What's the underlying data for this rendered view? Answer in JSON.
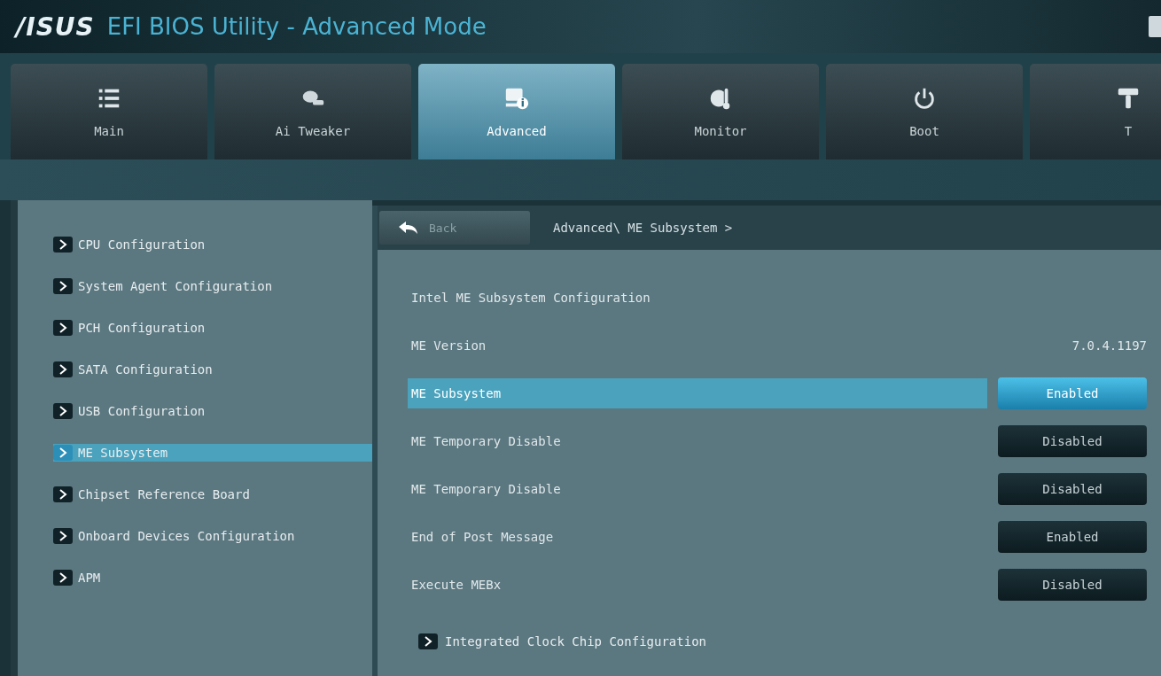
{
  "window": {
    "title_brand": "/ISUS",
    "title": "EFI BIOS Utility - Advanced Mode"
  },
  "tabs": [
    {
      "label": "Main",
      "kind": "list",
      "selected": false
    },
    {
      "label": "Ai Tweaker",
      "kind": "tweak",
      "selected": false
    },
    {
      "label": "Advanced",
      "kind": "advanced",
      "selected": true
    },
    {
      "label": "Monitor",
      "kind": "monitor",
      "selected": false
    },
    {
      "label": "Boot",
      "kind": "power",
      "selected": false
    },
    {
      "label": "T",
      "kind": "tool",
      "selected": false
    }
  ],
  "sidebar": {
    "items": [
      {
        "label": "CPU Configuration",
        "selected": false
      },
      {
        "label": "System Agent Configuration",
        "selected": false
      },
      {
        "label": "PCH Configuration",
        "selected": false
      },
      {
        "label": "SATA Configuration",
        "selected": false
      },
      {
        "label": "USB Configuration",
        "selected": false
      },
      {
        "label": "ME Subsystem",
        "selected": true
      },
      {
        "label": "Chipset Reference Board",
        "selected": false
      },
      {
        "label": "Onboard Devices Configuration",
        "selected": false
      },
      {
        "label": "APM",
        "selected": false
      }
    ]
  },
  "header": {
    "back": "Back",
    "breadcrumb": "Advanced\\ ME Subsystem >"
  },
  "settings": [
    {
      "kind": "heading",
      "label": "Intel ME Subsystem Configuration"
    },
    {
      "kind": "info",
      "label": "ME Version",
      "value": "7.0.4.1197"
    },
    {
      "kind": "option",
      "label": "ME Subsystem",
      "value": "Enabled",
      "selected": true
    },
    {
      "kind": "option",
      "label": "ME Temporary Disable",
      "value": "Disabled",
      "selected": false
    },
    {
      "kind": "option",
      "label": "ME Temporary Disable",
      "value": "Disabled",
      "selected": false
    },
    {
      "kind": "option",
      "label": "End of Post Message",
      "value": "Enabled",
      "selected": false
    },
    {
      "kind": "option",
      "label": "Execute MEBx",
      "value": "Disabled",
      "selected": false
    },
    {
      "kind": "submenu",
      "label": "Integrated Clock Chip Configuration"
    }
  ]
}
